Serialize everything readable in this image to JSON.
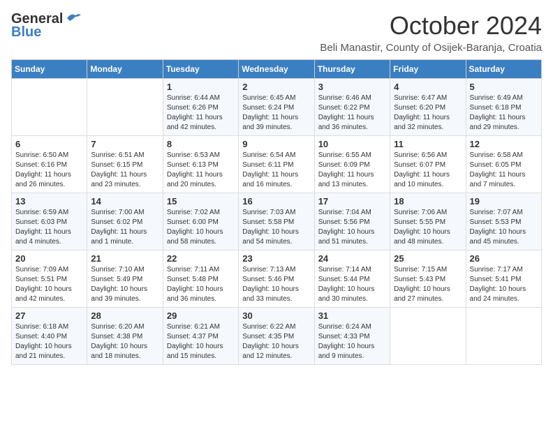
{
  "header": {
    "logo_line1": "General",
    "logo_line2": "Blue",
    "month": "October 2024",
    "location": "Beli Manastir, County of Osijek-Baranja, Croatia"
  },
  "days_of_week": [
    "Sunday",
    "Monday",
    "Tuesday",
    "Wednesday",
    "Thursday",
    "Friday",
    "Saturday"
  ],
  "weeks": [
    [
      {
        "day": "",
        "info": ""
      },
      {
        "day": "",
        "info": ""
      },
      {
        "day": "1",
        "info": "Sunrise: 6:44 AM\nSunset: 6:26 PM\nDaylight: 11 hours\nand 42 minutes."
      },
      {
        "day": "2",
        "info": "Sunrise: 6:45 AM\nSunset: 6:24 PM\nDaylight: 11 hours\nand 39 minutes."
      },
      {
        "day": "3",
        "info": "Sunrise: 6:46 AM\nSunset: 6:22 PM\nDaylight: 11 hours\nand 36 minutes."
      },
      {
        "day": "4",
        "info": "Sunrise: 6:47 AM\nSunset: 6:20 PM\nDaylight: 11 hours\nand 32 minutes."
      },
      {
        "day": "5",
        "info": "Sunrise: 6:49 AM\nSunset: 6:18 PM\nDaylight: 11 hours\nand 29 minutes."
      }
    ],
    [
      {
        "day": "6",
        "info": "Sunrise: 6:50 AM\nSunset: 6:16 PM\nDaylight: 11 hours\nand 26 minutes."
      },
      {
        "day": "7",
        "info": "Sunrise: 6:51 AM\nSunset: 6:15 PM\nDaylight: 11 hours\nand 23 minutes."
      },
      {
        "day": "8",
        "info": "Sunrise: 6:53 AM\nSunset: 6:13 PM\nDaylight: 11 hours\nand 20 minutes."
      },
      {
        "day": "9",
        "info": "Sunrise: 6:54 AM\nSunset: 6:11 PM\nDaylight: 11 hours\nand 16 minutes."
      },
      {
        "day": "10",
        "info": "Sunrise: 6:55 AM\nSunset: 6:09 PM\nDaylight: 11 hours\nand 13 minutes."
      },
      {
        "day": "11",
        "info": "Sunrise: 6:56 AM\nSunset: 6:07 PM\nDaylight: 11 hours\nand 10 minutes."
      },
      {
        "day": "12",
        "info": "Sunrise: 6:58 AM\nSunset: 6:05 PM\nDaylight: 11 hours\nand 7 minutes."
      }
    ],
    [
      {
        "day": "13",
        "info": "Sunrise: 6:59 AM\nSunset: 6:03 PM\nDaylight: 11 hours\nand 4 minutes."
      },
      {
        "day": "14",
        "info": "Sunrise: 7:00 AM\nSunset: 6:02 PM\nDaylight: 11 hours\nand 1 minute."
      },
      {
        "day": "15",
        "info": "Sunrise: 7:02 AM\nSunset: 6:00 PM\nDaylight: 10 hours\nand 58 minutes."
      },
      {
        "day": "16",
        "info": "Sunrise: 7:03 AM\nSunset: 5:58 PM\nDaylight: 10 hours\nand 54 minutes."
      },
      {
        "day": "17",
        "info": "Sunrise: 7:04 AM\nSunset: 5:56 PM\nDaylight: 10 hours\nand 51 minutes."
      },
      {
        "day": "18",
        "info": "Sunrise: 7:06 AM\nSunset: 5:55 PM\nDaylight: 10 hours\nand 48 minutes."
      },
      {
        "day": "19",
        "info": "Sunrise: 7:07 AM\nSunset: 5:53 PM\nDaylight: 10 hours\nand 45 minutes."
      }
    ],
    [
      {
        "day": "20",
        "info": "Sunrise: 7:09 AM\nSunset: 5:51 PM\nDaylight: 10 hours\nand 42 minutes."
      },
      {
        "day": "21",
        "info": "Sunrise: 7:10 AM\nSunset: 5:49 PM\nDaylight: 10 hours\nand 39 minutes."
      },
      {
        "day": "22",
        "info": "Sunrise: 7:11 AM\nSunset: 5:48 PM\nDaylight: 10 hours\nand 36 minutes."
      },
      {
        "day": "23",
        "info": "Sunrise: 7:13 AM\nSunset: 5:46 PM\nDaylight: 10 hours\nand 33 minutes."
      },
      {
        "day": "24",
        "info": "Sunrise: 7:14 AM\nSunset: 5:44 PM\nDaylight: 10 hours\nand 30 minutes."
      },
      {
        "day": "25",
        "info": "Sunrise: 7:15 AM\nSunset: 5:43 PM\nDaylight: 10 hours\nand 27 minutes."
      },
      {
        "day": "26",
        "info": "Sunrise: 7:17 AM\nSunset: 5:41 PM\nDaylight: 10 hours\nand 24 minutes."
      }
    ],
    [
      {
        "day": "27",
        "info": "Sunrise: 6:18 AM\nSunset: 4:40 PM\nDaylight: 10 hours\nand 21 minutes."
      },
      {
        "day": "28",
        "info": "Sunrise: 6:20 AM\nSunset: 4:38 PM\nDaylight: 10 hours\nand 18 minutes."
      },
      {
        "day": "29",
        "info": "Sunrise: 6:21 AM\nSunset: 4:37 PM\nDaylight: 10 hours\nand 15 minutes."
      },
      {
        "day": "30",
        "info": "Sunrise: 6:22 AM\nSunset: 4:35 PM\nDaylight: 10 hours\nand 12 minutes."
      },
      {
        "day": "31",
        "info": "Sunrise: 6:24 AM\nSunset: 4:33 PM\nDaylight: 10 hours\nand 9 minutes."
      },
      {
        "day": "",
        "info": ""
      },
      {
        "day": "",
        "info": ""
      }
    ]
  ]
}
